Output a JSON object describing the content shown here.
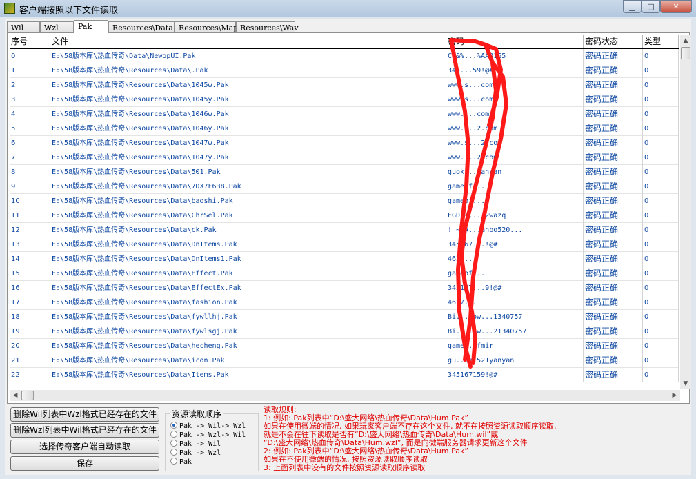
{
  "window": {
    "title": "客户端按照以下文件读取",
    "minimize": "▁",
    "maximize": "□",
    "close": "✕"
  },
  "tabs": [
    "Wil",
    "Wzl",
    "Pak",
    "Resources\\Data",
    "Resources\\Map",
    "Resources\\Wav"
  ],
  "active_tab": "Pak",
  "table": {
    "columns": [
      "序号",
      "文件",
      "密码",
      "密码状态",
      "类型"
    ],
    "rows": [
      {
        "num": "0",
        "file": "E:\\58版本库\\热血传奇\\Data\\NewopUI.Pak",
        "pwd": "C0&%...%AA0165",
        "status": "密码正确",
        "type": "0"
      },
      {
        "num": "1",
        "file": "E:\\58版本库\\热血传奇\\Resources\\Data\\.Pak",
        "pwd": "345...59!@#",
        "status": "密码正确",
        "type": "0"
      },
      {
        "num": "2",
        "file": "E:\\58版本库\\热血传奇\\Resources\\Data\\1045w.Pak",
        "pwd": "www.s...com",
        "status": "密码正确",
        "type": "0"
      },
      {
        "num": "3",
        "file": "E:\\58版本库\\热血传奇\\Resources\\Data\\1045y.Pak",
        "pwd": "www.s...com",
        "status": "密码正确",
        "type": "0"
      },
      {
        "num": "4",
        "file": "E:\\58版本库\\热血传奇\\Resources\\Data\\1046w.Pak",
        "pwd": "www....com",
        "status": "密码正确",
        "type": "0"
      },
      {
        "num": "5",
        "file": "E:\\58版本库\\热血传奇\\Resources\\Data\\1046y.Pak",
        "pwd": "www....2.com",
        "status": "密码正确",
        "type": "0"
      },
      {
        "num": "6",
        "file": "E:\\58版本库\\热血传奇\\Resources\\Data\\1047w.Pak",
        "pwd": "www.s...2.com",
        "status": "密码正确",
        "type": "0"
      },
      {
        "num": "7",
        "file": "E:\\58版本库\\热血传奇\\Resources\\Data\\1047y.Pak",
        "pwd": "www....2.com",
        "status": "密码正确",
        "type": "0"
      },
      {
        "num": "8",
        "file": "E:\\58版本库\\热血传奇\\Resources\\Data\\501.Pak",
        "pwd": "guok...yanyan",
        "status": "密码正确",
        "type": "0"
      },
      {
        "num": "9",
        "file": "E:\\58版本库\\热血传奇\\Resources\\Data\\7DX7F638.Pak",
        "pwd": "gameof...",
        "status": "密码正确",
        "type": "0"
      },
      {
        "num": "10",
        "file": "E:\\58版本库\\热血传奇\\Resources\\Data\\baoshi.Pak",
        "pwd": "gameof...",
        "status": "密码正确",
        "type": "0"
      },
      {
        "num": "11",
        "file": "E:\\58版本库\\热血传奇\\Resources\\Data\\ChrSel.Pak",
        "pwd": "EGD3+...!2wazq",
        "status": "密码正确",
        "type": "0"
      },
      {
        "num": "12",
        "file": "E:\\58版本库\\热血传奇\\Resources\\Data\\ck.Pak",
        "pwd": "! ~YA...anbo520...",
        "status": "密码正确",
        "type": "0"
      },
      {
        "num": "13",
        "file": "E:\\58版本库\\热血传奇\\Resources\\Data\\DnItems.Pak",
        "pwd": "345167...!@#",
        "status": "密码正确",
        "type": "0"
      },
      {
        "num": "14",
        "file": "E:\\58版本库\\热血传奇\\Resources\\Data\\DnItems1.Pak",
        "pwd": "4627...",
        "status": "密码正确",
        "type": "0"
      },
      {
        "num": "15",
        "file": "E:\\58版本库\\热血传奇\\Resources\\Data\\Effect.Pak",
        "pwd": "gameof...",
        "status": "密码正确",
        "type": "0"
      },
      {
        "num": "16",
        "file": "E:\\58版本库\\热血传奇\\Resources\\Data\\EffectEx.Pak",
        "pwd": "345167...9!@#",
        "status": "密码正确",
        "type": "0"
      },
      {
        "num": "17",
        "file": "E:\\58版本库\\热血传奇\\Resources\\Data\\fashion.Pak",
        "pwd": "4627...",
        "status": "密码正确",
        "type": "0"
      },
      {
        "num": "18",
        "file": "E:\\58版本库\\热血传奇\\Resources\\Data\\fywllhj.Pak",
        "pwd": "Bi...low...1340757",
        "status": "密码正确",
        "type": "0"
      },
      {
        "num": "19",
        "file": "E:\\58版本库\\热血传奇\\Resources\\Data\\fywlsgj.Pak",
        "pwd": "Bi...low...21340757",
        "status": "密码正确",
        "type": "0"
      },
      {
        "num": "20",
        "file": "E:\\58版本库\\热血传奇\\Resources\\Data\\hecheng.Pak",
        "pwd": "game...fmir",
        "status": "密码正确",
        "type": "0"
      },
      {
        "num": "21",
        "file": "E:\\58版本库\\热血传奇\\Resources\\Data\\icon.Pak",
        "pwd": "gu...ai521yanyan",
        "status": "密码正确",
        "type": "0"
      },
      {
        "num": "22",
        "file": "E:\\58版本库\\热血传奇\\Resources\\Data\\Items.Pak",
        "pwd": "345167159!@#",
        "status": "密码正确",
        "type": "0"
      }
    ]
  },
  "buttons": {
    "delete_wil": "删除Wil列表中Wzl格式已经存在的文件",
    "delete_wzl": "删除Wzl列表中Wil格式已经存在的文件",
    "auto_read": "选择传奇客户端自动读取",
    "save": "保存"
  },
  "order_group": {
    "title": "资源读取顺序",
    "options": [
      "Pak -> Wil-> Wzl",
      "Pak -> Wzl-> Wil",
      "Pak -> Wil",
      "Pak -> Wzl",
      "Pak"
    ],
    "selected": 0
  },
  "rules": [
    "读取规则:",
    "1: 例如: Pak列表中“D:\\盛大网络\\热血传奇\\Data\\Hum.Pak”",
    "    如果在使用微端的情况, 如果玩家客户端不存在这个文件, 就不在按照资源读取顺序读取,",
    "    就是不会在往下读取是否有“D:\\盛大网络\\热血传奇\\Data\\Hum.wil”或",
    "    “D:\\盛大网络\\热血传奇\\Data\\Hum.wzl”, 而是向微端服务器请求更新这个文件",
    "2: 例如: Pak列表中“D:\\盛大网络\\热血传奇\\Data\\Hum.Pak”",
    "    如果在不使用微端的情况, 按照资源读取顺序读取",
    "3: 上面列表中没有的文件按照资源读取顺序读取"
  ],
  "colors": {
    "link_text": "#0d47a1",
    "rules_text": "#e00000",
    "scribble": "#ff1a1a"
  }
}
